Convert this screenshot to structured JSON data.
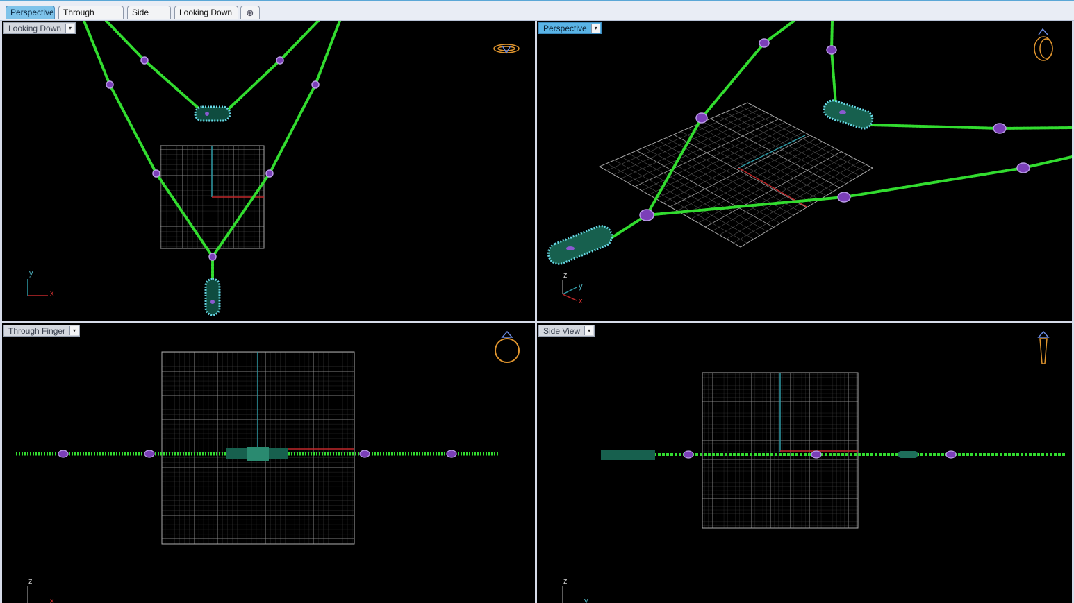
{
  "tabs": [
    {
      "label": "Perspective",
      "active": true
    },
    {
      "label": "Through Finger",
      "active": false
    },
    {
      "label": "Side View",
      "active": false
    },
    {
      "label": "Looking Down",
      "active": false
    }
  ],
  "add_tab_glyph": "⊕",
  "viewports": {
    "top_left": {
      "label": "Looking Down",
      "dropdown_glyph": "▾",
      "axis_a": "y",
      "axis_b": "x",
      "nav_icon": "ring-top-view-icon"
    },
    "top_right": {
      "label": "Perspective",
      "dropdown_glyph": "▾",
      "axis_a": "z",
      "axis_b": "y",
      "axis_c": "x",
      "nav_icon": "ring-perspective-icon"
    },
    "bottom_left": {
      "label": "Through Finger",
      "dropdown_glyph": "▾",
      "axis_a": "z",
      "axis_b": "x",
      "nav_icon": "ring-front-view-icon"
    },
    "bottom_right": {
      "label": "Side View",
      "dropdown_glyph": "▾",
      "axis_a": "z",
      "axis_b": "y",
      "nav_icon": "ring-side-view-icon"
    }
  },
  "colors": {
    "active_tab": "#7ec3ea",
    "chain": "#32dc2f",
    "bead": "#7b3fb8",
    "pendant": "#1e6e5a",
    "stones": "#68d8e6",
    "grid": "#8c8c8c",
    "axis_x": "#c0282a",
    "axis_y": "#2f9aa6",
    "nav_icon": "#e0952e"
  }
}
